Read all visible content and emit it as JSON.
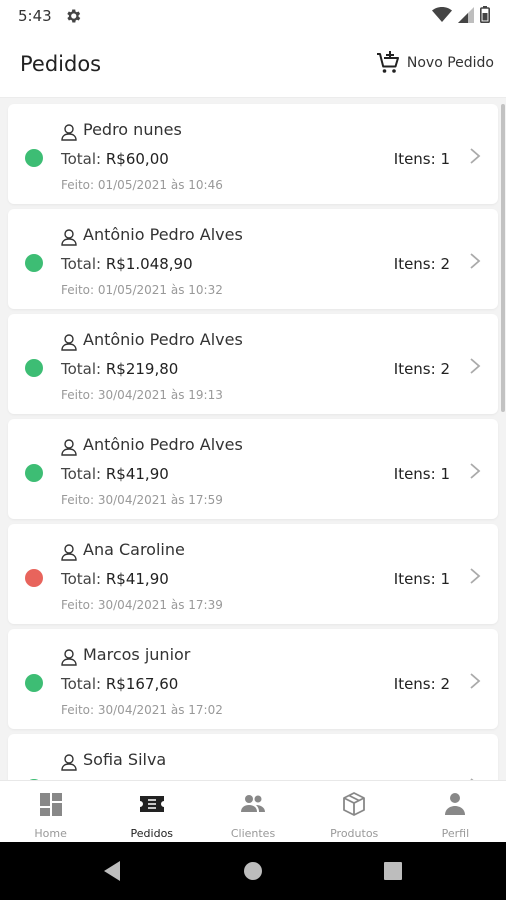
{
  "status": {
    "time": "5:43"
  },
  "header": {
    "title": "Pedidos",
    "new_order_label": "Novo Pedido"
  },
  "orders": [
    {
      "client": "Pedro nunes",
      "total_label": "Total:",
      "total": "R$60,00",
      "items": "Itens: 1",
      "date": "Feito: 01/05/2021 às 10:46",
      "status_color": "#3dbd74"
    },
    {
      "client": "Antônio Pedro Alves",
      "total_label": "Total:",
      "total": "R$1.048,90",
      "items": "Itens: 2",
      "date": "Feito: 01/05/2021 às 10:32",
      "status_color": "#3dbd74"
    },
    {
      "client": "Antônio Pedro Alves",
      "total_label": "Total:",
      "total": "R$219,80",
      "items": "Itens: 2",
      "date": "Feito: 30/04/2021 às 19:13",
      "status_color": "#3dbd74"
    },
    {
      "client": "Antônio Pedro Alves",
      "total_label": "Total:",
      "total": "R$41,90",
      "items": "Itens: 1",
      "date": "Feito: 30/04/2021 às 17:59",
      "status_color": "#3dbd74"
    },
    {
      "client": "Ana Caroline",
      "total_label": "Total:",
      "total": "R$41,90",
      "items": "Itens: 1",
      "date": "Feito: 30/04/2021 às 17:39",
      "status_color": "#e8645c"
    },
    {
      "client": "Marcos junior",
      "total_label": "Total:",
      "total": "R$167,60",
      "items": "Itens: 2",
      "date": "Feito: 30/04/2021 às 17:02",
      "status_color": "#3dbd74"
    },
    {
      "client": "Sofia Silva",
      "total_label": "",
      "total": "",
      "items": "",
      "date": "",
      "status_color": "#3dbd74"
    }
  ],
  "nav": {
    "items": [
      {
        "label": "Home",
        "icon": "dashboard-icon"
      },
      {
        "label": "Pedidos",
        "icon": "ticket-icon"
      },
      {
        "label": "Clientes",
        "icon": "people-icon"
      },
      {
        "label": "Produtos",
        "icon": "box-icon"
      },
      {
        "label": "Perfil",
        "icon": "person-icon"
      }
    ],
    "active": "Pedidos"
  },
  "colors": {
    "status_done": "#3dbd74",
    "status_cancelled": "#e8645c",
    "nav_active": "#222222",
    "nav_inactive": "#999999"
  }
}
